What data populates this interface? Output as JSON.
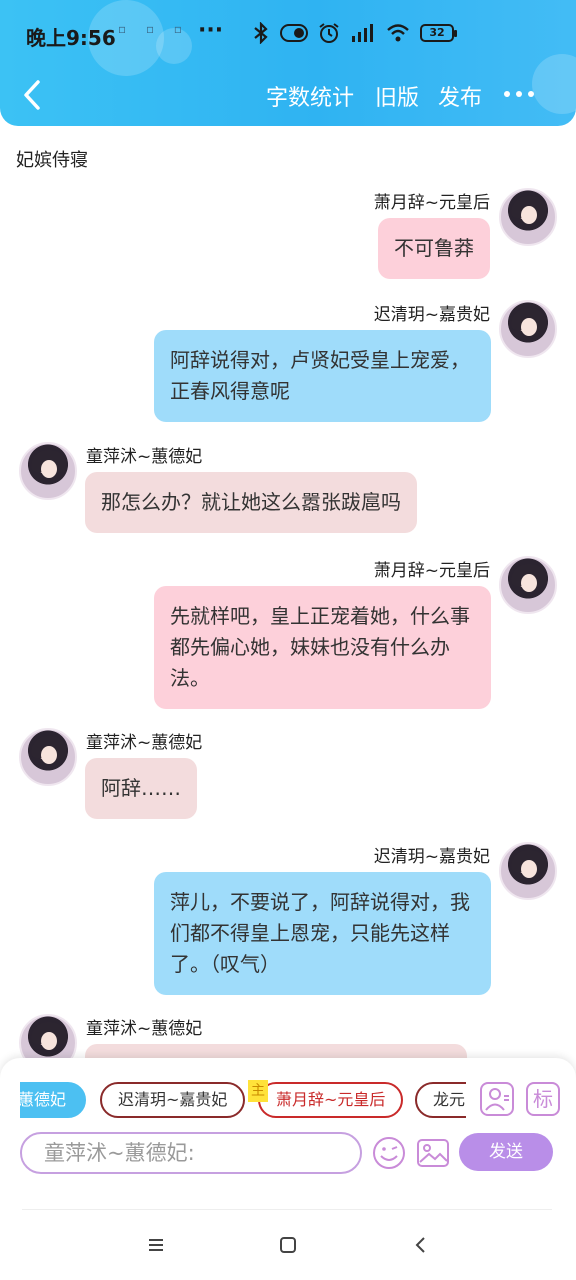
{
  "status_bar": {
    "time": "晚上9:56",
    "more": "···",
    "battery": "32"
  },
  "nav": {
    "word_count": "字数统计",
    "old_version": "旧版",
    "publish": "发布"
  },
  "room_title": "妃嫔侍寝",
  "messages": [
    {
      "side": "right",
      "name": "萧月辞~元皇后",
      "text": "不可鲁莽",
      "color": "#fdd0da"
    },
    {
      "side": "right",
      "name": "迟清玥~嘉贵妃",
      "text": "阿辞说得对，卢贤妃受皇上宠爱，正春风得意呢",
      "color": "#9fdcfa"
    },
    {
      "side": "left",
      "name": "童萍沭~蕙德妃",
      "text": "那怎么办？就让她这么嚣张跋扈吗",
      "color": "#f3dcdd"
    },
    {
      "side": "right",
      "name": "萧月辞~元皇后",
      "text": "先就样吧，皇上正宠着她，什么事都先偏心她，妹妹也没有什么办法。",
      "color": "#fdd0da"
    },
    {
      "side": "left",
      "name": "童萍沭~蕙德妃",
      "text": "阿辞……",
      "color": "#f3dcdd"
    },
    {
      "side": "right",
      "name": "迟清玥~嘉贵妃",
      "text": "萍儿，不要说了，阿辞说得对，我们都不得皇上恩宠，只能先这样了。（叹气）",
      "color": "#9fdcfa"
    },
    {
      "side": "left",
      "name": "童萍沭~蕙德妃",
      "text": "",
      "color": "#f3dcdd"
    }
  ],
  "composer": {
    "roles": [
      "蕙德妃",
      "迟清玥~嘉贵妃",
      "萧月辞~元皇后",
      "龙元"
    ],
    "host_tag": "主",
    "tag_button": "标",
    "input_placeholder": "童萍沭~蕙德妃:",
    "send": "发送"
  },
  "icons": {
    "back": "chevron-left-icon",
    "more": "more-dots-icon",
    "person": "person-icon",
    "emoji": "emoji-icon",
    "image": "image-icon",
    "home": "square-home-icon",
    "menu": "menu-icon",
    "sys_back": "chevron-left-icon"
  },
  "colors": {
    "header": "#2fb3f2",
    "send": "#b98ee8",
    "active_role": "#4cc0f2"
  }
}
